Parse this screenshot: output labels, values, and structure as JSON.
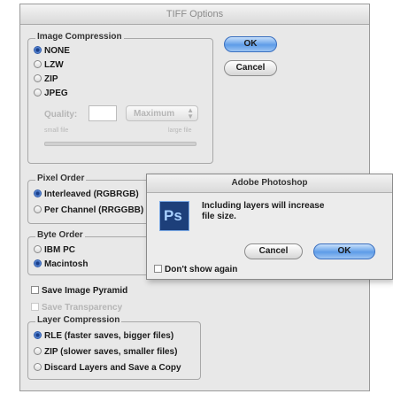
{
  "window": {
    "title": "TIFF Options",
    "ok_label": "OK",
    "cancel_label": "Cancel"
  },
  "image_compression": {
    "legend": "Image Compression",
    "options": [
      {
        "label": "NONE",
        "selected": true
      },
      {
        "label": "LZW",
        "selected": false
      },
      {
        "label": "ZIP",
        "selected": false
      },
      {
        "label": "JPEG",
        "selected": false
      }
    ],
    "quality_label": "Quality:",
    "quality_value": "",
    "quality_select": "Maximum",
    "small_file_label": "small file",
    "large_file_label": "large file"
  },
  "pixel_order": {
    "legend": "Pixel Order",
    "options": [
      {
        "label": "Interleaved (RGBRGB)",
        "selected": true
      },
      {
        "label": "Per Channel (RRGGBB)",
        "selected": false
      }
    ]
  },
  "byte_order": {
    "legend": "Byte Order",
    "options": [
      {
        "label": "IBM PC",
        "selected": false
      },
      {
        "label": "Macintosh",
        "selected": true
      }
    ]
  },
  "checkboxes": {
    "save_image_pyramid": "Save Image Pyramid",
    "save_transparency": "Save Transparency"
  },
  "layer_compression": {
    "legend": "Layer Compression",
    "options": [
      {
        "label": "RLE (faster saves, bigger files)",
        "selected": true
      },
      {
        "label": "ZIP (slower saves, smaller files)",
        "selected": false
      },
      {
        "label": "Discard Layers and Save a Copy",
        "selected": false
      }
    ]
  },
  "alert": {
    "title": "Adobe Photoshop",
    "icon_text": "Ps",
    "message": "Including layers will increase file size.",
    "cancel_label": "Cancel",
    "ok_label": "OK",
    "dont_show_label": "Don't show again"
  },
  "colors": {
    "accent_blue": "#5e9ce8",
    "ps_icon_bg": "#1d3f7a"
  }
}
